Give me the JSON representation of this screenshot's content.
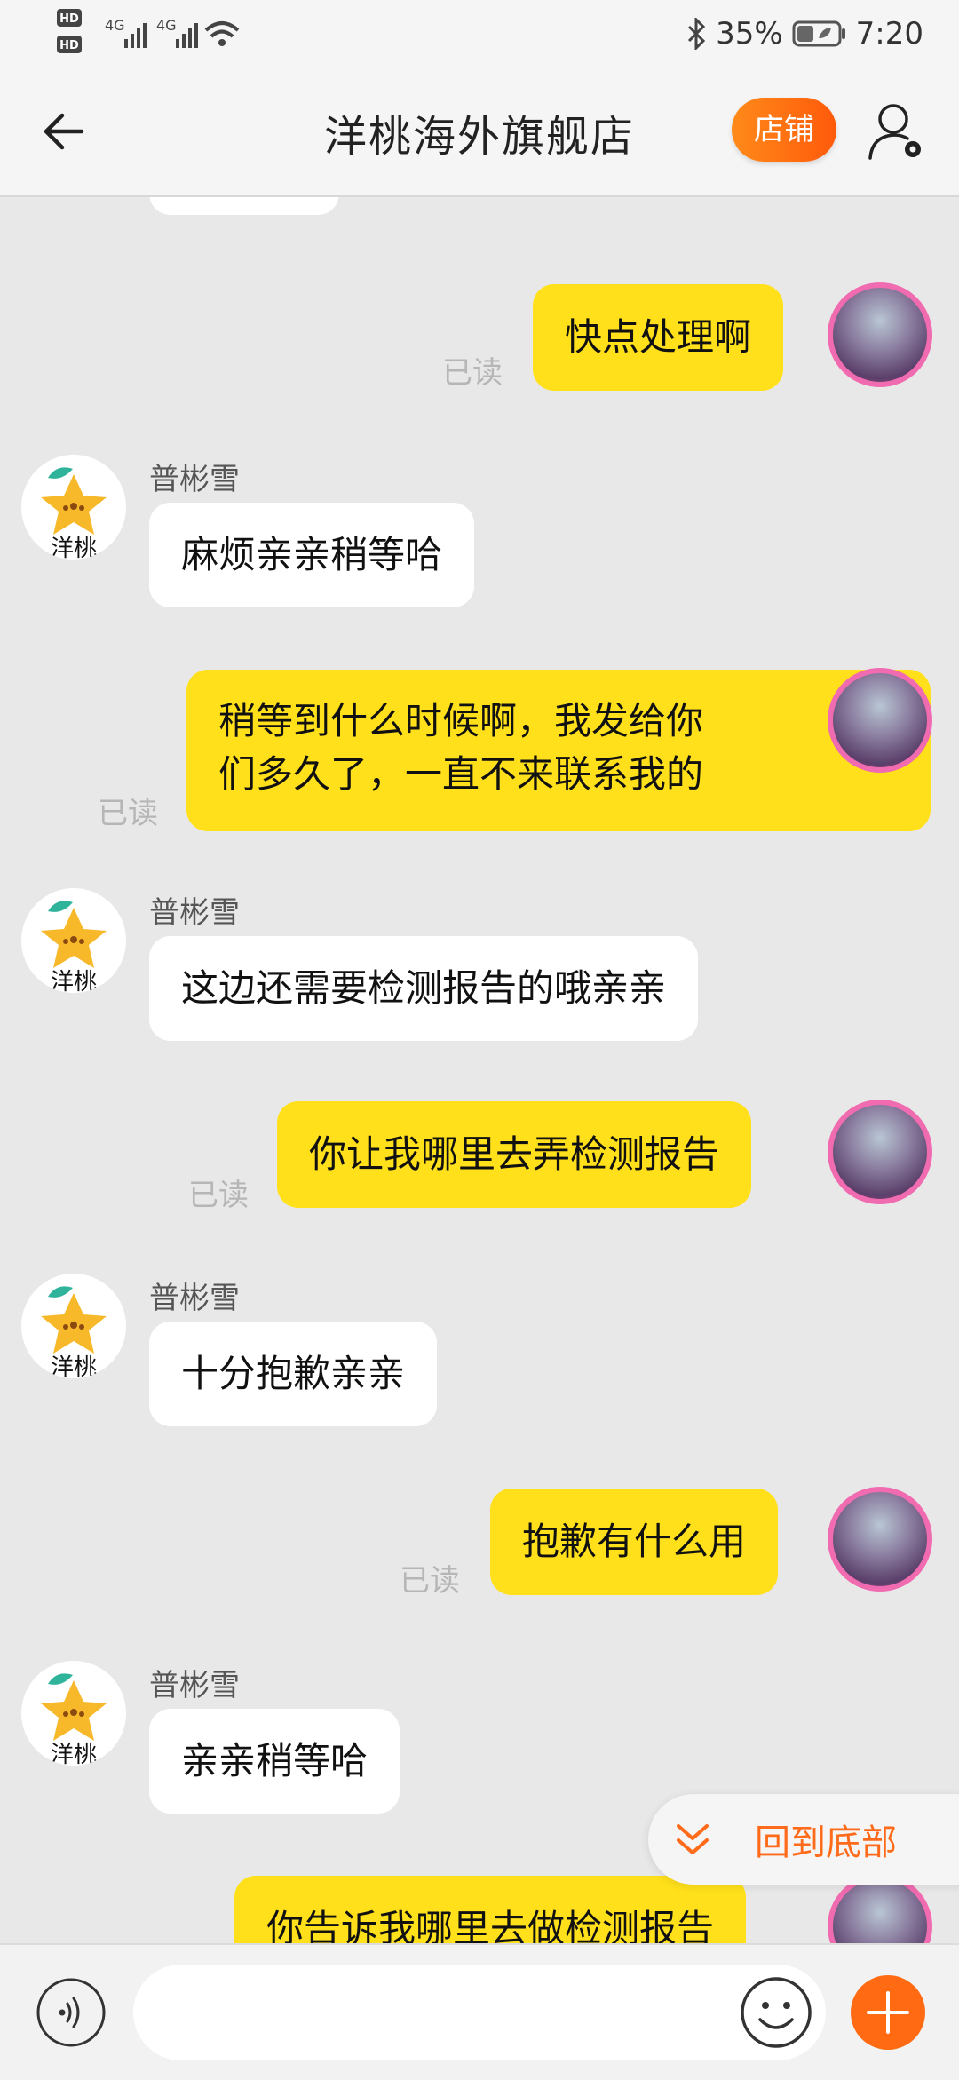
{
  "status_bar": {
    "hd1": "HD",
    "hd2": "HD",
    "net1": "4G",
    "net2": "4G",
    "battery": "35%",
    "time": "7:20"
  },
  "header": {
    "title": "洋桃海外旗舰店",
    "shop_button": "店铺"
  },
  "messages": [
    {
      "side": "mine",
      "text": "快点处理啊",
      "status": "已读"
    },
    {
      "side": "theirs",
      "sender": "普彬雪",
      "text": "麻烦亲亲稍等哈"
    },
    {
      "side": "mine",
      "line1": "稍等到什么时候啊，我发给你",
      "line2": "们多久了，一直不来联系我的",
      "status": "已读"
    },
    {
      "side": "theirs",
      "sender": "普彬雪",
      "text": "这边还需要检测报告的哦亲亲"
    },
    {
      "side": "mine",
      "text": "你让我哪里去弄检测报告",
      "status": "已读"
    },
    {
      "side": "theirs",
      "sender": "普彬雪",
      "text": "十分抱歉亲亲"
    },
    {
      "side": "mine",
      "text": "抱歉有什么用",
      "status": "已读"
    },
    {
      "side": "theirs",
      "sender": "普彬雪",
      "text": "亲亲稍等哈"
    },
    {
      "side": "mine",
      "text": "你告诉我哪里去做检测报告"
    }
  ],
  "shop_avatar_text": "洋桃",
  "scroll_to_bottom": "回到底部",
  "input": {
    "placeholder": ""
  },
  "icons": {
    "back": "arrow-left-icon",
    "user": "user-settings-icon",
    "voice": "voice-icon",
    "emoji": "smiley-icon",
    "plus": "plus-icon",
    "chevron": "double-chevron-down-icon"
  },
  "colors": {
    "mine_bubble": "#ffe01b",
    "theirs_bubble": "#ffffff",
    "accent": "#ff6a12"
  }
}
